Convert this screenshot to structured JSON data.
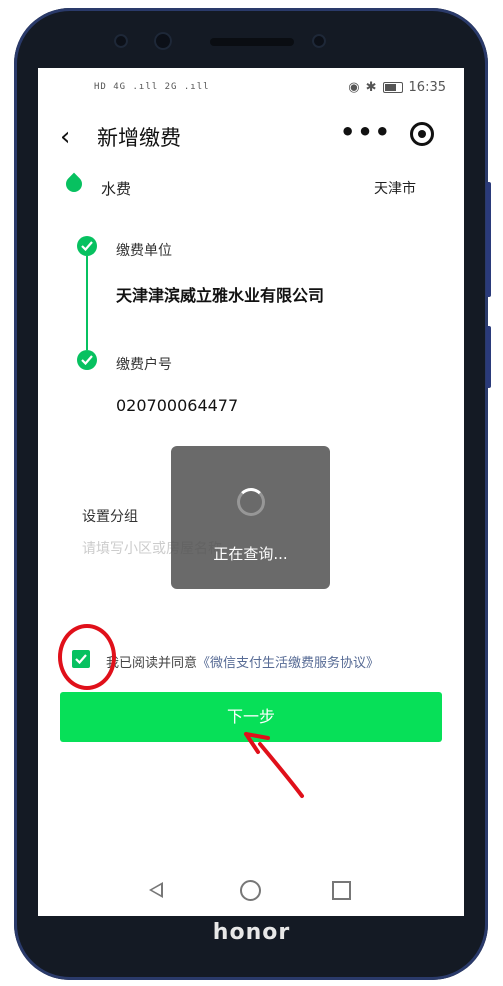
{
  "device": {
    "brand": "honor"
  },
  "status_bar": {
    "left_icons": "HD 4G .ıll 2G .ıll",
    "time": "16:35"
  },
  "nav": {
    "title": "新增缴费"
  },
  "service": {
    "name": "水费",
    "city": "天津市"
  },
  "steps": [
    {
      "label": "缴费单位",
      "value": "天津津滨威立雅水业有限公司"
    },
    {
      "label": "缴费户号",
      "value": "020700064477"
    }
  ],
  "group": {
    "label": "设置分组",
    "placeholder": "请填写小区或房屋名称"
  },
  "toast": {
    "text": "正在查询..."
  },
  "agreement": {
    "prefix": "我已阅读并同意",
    "link": "《微信支付生活缴费服务协议》",
    "checked": true
  },
  "next_button": {
    "label": "下一步"
  },
  "colors": {
    "accent": "#07c160",
    "button": "#07e058",
    "annotation": "#e0101a",
    "link": "#576b95"
  }
}
